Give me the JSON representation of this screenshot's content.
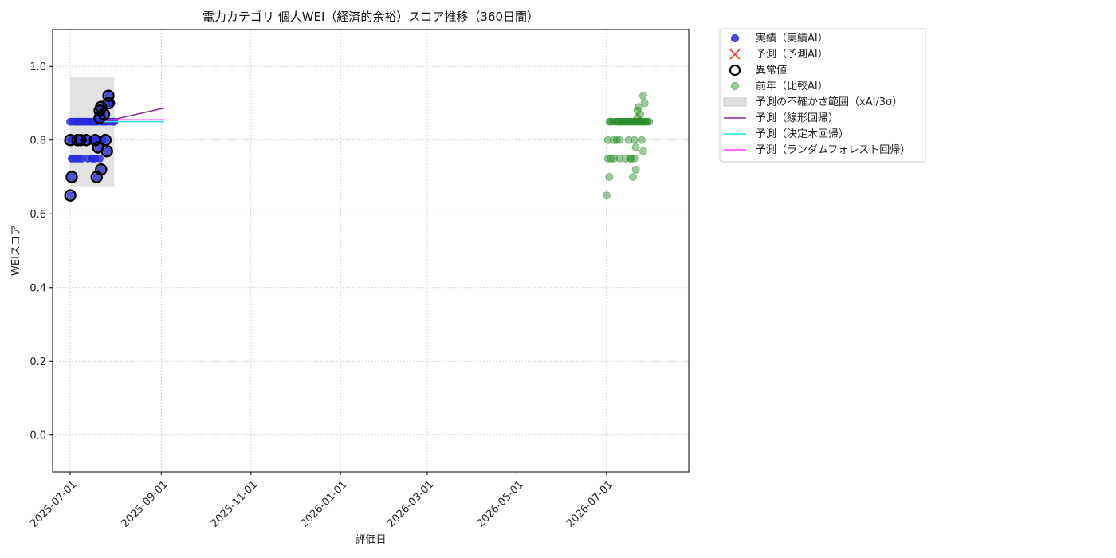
{
  "chart_data": {
    "type": "scatter",
    "title": "電力カテゴリ 個人WEI（経済的余裕）スコア推移（360日間）",
    "xlabel": "評価日",
    "ylabel": "WEIスコア",
    "xlim": [
      "2025-06-19",
      "2026-08-26"
    ],
    "ylim": [
      -0.1,
      1.1
    ],
    "x_ticks": [
      "2025-07-01",
      "2025-09-01",
      "2025-11-01",
      "2026-01-01",
      "2026-03-01",
      "2026-05-01",
      "2026-07-01"
    ],
    "y_ticks": [
      0.0,
      0.2,
      0.4,
      0.6,
      0.8,
      1.0
    ],
    "y_tick_labels": [
      "0.0",
      "0.2",
      "0.4",
      "0.6",
      "0.8",
      "1.0"
    ],
    "grid": true,
    "legend_placement": "outside-top-right",
    "colors": {
      "actual": "#2b2bdc",
      "predicted": "#ff3b3b",
      "anomaly": "#000000",
      "last_year": "#228b22",
      "uncertainty": "#d3d3d3",
      "linear": "#8e2c9a",
      "tree": "#22e0ee",
      "forest": "#ff33ff"
    },
    "series": [
      {
        "name": "実績（実績AI）",
        "kind": "scatter",
        "points": [
          [
            "2025-07-01",
            0.65
          ],
          [
            "2025-07-01",
            0.8
          ],
          [
            "2025-07-01",
            0.85
          ],
          [
            "2025-07-02",
            0.7
          ],
          [
            "2025-07-02",
            0.75
          ],
          [
            "2025-07-02",
            0.8
          ],
          [
            "2025-07-03",
            0.85
          ],
          [
            "2025-07-03",
            0.75
          ],
          [
            "2025-07-04",
            0.85
          ],
          [
            "2025-07-04",
            0.8
          ],
          [
            "2025-07-05",
            0.75
          ],
          [
            "2025-07-05",
            0.85
          ],
          [
            "2025-07-06",
            0.8
          ],
          [
            "2025-07-06",
            0.85
          ],
          [
            "2025-07-07",
            0.75
          ],
          [
            "2025-07-07",
            0.85
          ],
          [
            "2025-07-08",
            0.8
          ],
          [
            "2025-07-08",
            0.85
          ],
          [
            "2025-07-09",
            0.85
          ],
          [
            "2025-07-09",
            0.75
          ],
          [
            "2025-07-10",
            0.8
          ],
          [
            "2025-07-10",
            0.85
          ],
          [
            "2025-07-11",
            0.85
          ],
          [
            "2025-07-12",
            0.8
          ],
          [
            "2025-07-12",
            0.85
          ],
          [
            "2025-07-13",
            0.75
          ],
          [
            "2025-07-13",
            0.85
          ],
          [
            "2025-07-14",
            0.85
          ],
          [
            "2025-07-15",
            0.85
          ],
          [
            "2025-07-16",
            0.75
          ],
          [
            "2025-07-16",
            0.8
          ],
          [
            "2025-07-16",
            0.85
          ],
          [
            "2025-07-17",
            0.85
          ],
          [
            "2025-07-17",
            0.75
          ],
          [
            "2025-07-18",
            0.75
          ],
          [
            "2025-07-18",
            0.8
          ],
          [
            "2025-07-18",
            0.85
          ],
          [
            "2025-07-19",
            0.7
          ],
          [
            "2025-07-19",
            0.85
          ],
          [
            "2025-07-20",
            0.8
          ],
          [
            "2025-07-20",
            0.85
          ],
          [
            "2025-07-20",
            0.78
          ],
          [
            "2025-07-21",
            0.75
          ],
          [
            "2025-07-21",
            0.88
          ],
          [
            "2025-07-21",
            0.86
          ],
          [
            "2025-07-22",
            0.72
          ],
          [
            "2025-07-22",
            0.85
          ],
          [
            "2025-07-22",
            0.89
          ],
          [
            "2025-07-23",
            0.85
          ],
          [
            "2025-07-23",
            0.8
          ],
          [
            "2025-07-24",
            0.87
          ],
          [
            "2025-07-24",
            0.85
          ],
          [
            "2025-07-25",
            0.8
          ],
          [
            "2025-07-25",
            0.85
          ],
          [
            "2025-07-26",
            0.77
          ],
          [
            "2025-07-26",
            0.85
          ],
          [
            "2025-07-27",
            0.9
          ],
          [
            "2025-07-27",
            0.92
          ],
          [
            "2025-07-28",
            0.85
          ],
          [
            "2025-07-29",
            0.9
          ],
          [
            "2025-07-30",
            0.85
          ],
          [
            "2025-07-31",
            0.85
          ]
        ]
      },
      {
        "name": "予測（予測AI）",
        "kind": "scatter",
        "points": []
      },
      {
        "name": "異常値",
        "kind": "ring",
        "points": [
          [
            "2025-07-01",
            0.65
          ],
          [
            "2025-07-01",
            0.8
          ],
          [
            "2025-07-02",
            0.7
          ],
          [
            "2025-07-06",
            0.8
          ],
          [
            "2025-07-08",
            0.8
          ],
          [
            "2025-07-12",
            0.8
          ],
          [
            "2025-07-18",
            0.8
          ],
          [
            "2025-07-19",
            0.7
          ],
          [
            "2025-07-20",
            0.78
          ],
          [
            "2025-07-21",
            0.88
          ],
          [
            "2025-07-21",
            0.86
          ],
          [
            "2025-07-22",
            0.72
          ],
          [
            "2025-07-22",
            0.89
          ],
          [
            "2025-07-24",
            0.87
          ],
          [
            "2025-07-25",
            0.8
          ],
          [
            "2025-07-26",
            0.77
          ],
          [
            "2025-07-27",
            0.9
          ],
          [
            "2025-07-27",
            0.92
          ]
        ]
      },
      {
        "name": "前年（比較AI）",
        "kind": "scatter",
        "points": [
          [
            "2026-07-01",
            0.65
          ],
          [
            "2026-07-02",
            0.75
          ],
          [
            "2026-07-02",
            0.8
          ],
          [
            "2026-07-03",
            0.7
          ],
          [
            "2026-07-03",
            0.85
          ],
          [
            "2026-07-04",
            0.75
          ],
          [
            "2026-07-04",
            0.85
          ],
          [
            "2026-07-05",
            0.85
          ],
          [
            "2026-07-06",
            0.75
          ],
          [
            "2026-07-06",
            0.8
          ],
          [
            "2026-07-07",
            0.85
          ],
          [
            "2026-07-08",
            0.8
          ],
          [
            "2026-07-08",
            0.85
          ],
          [
            "2026-07-09",
            0.85
          ],
          [
            "2026-07-10",
            0.75
          ],
          [
            "2026-07-10",
            0.8
          ],
          [
            "2026-07-10",
            0.85
          ],
          [
            "2026-07-11",
            0.85
          ],
          [
            "2026-07-12",
            0.85
          ],
          [
            "2026-07-13",
            0.85
          ],
          [
            "2026-07-14",
            0.75
          ],
          [
            "2026-07-14",
            0.85
          ],
          [
            "2026-07-15",
            0.85
          ],
          [
            "2026-07-16",
            0.8
          ],
          [
            "2026-07-16",
            0.85
          ],
          [
            "2026-07-17",
            0.75
          ],
          [
            "2026-07-17",
            0.85
          ],
          [
            "2026-07-18",
            0.75
          ],
          [
            "2026-07-18",
            0.85
          ],
          [
            "2026-07-19",
            0.7
          ],
          [
            "2026-07-19",
            0.85
          ],
          [
            "2026-07-20",
            0.8
          ],
          [
            "2026-07-20",
            0.75
          ],
          [
            "2026-07-20",
            0.85
          ],
          [
            "2026-07-21",
            0.78
          ],
          [
            "2026-07-21",
            0.85
          ],
          [
            "2026-07-21",
            0.72
          ],
          [
            "2026-07-22",
            0.86
          ],
          [
            "2026-07-22",
            0.88
          ],
          [
            "2026-07-22",
            0.85
          ],
          [
            "2026-07-23",
            0.89
          ],
          [
            "2026-07-23",
            0.85
          ],
          [
            "2026-07-24",
            0.87
          ],
          [
            "2026-07-24",
            0.85
          ],
          [
            "2026-07-25",
            0.8
          ],
          [
            "2026-07-25",
            0.85
          ],
          [
            "2026-07-26",
            0.77
          ],
          [
            "2026-07-26",
            0.85
          ],
          [
            "2026-07-26",
            0.92
          ],
          [
            "2026-07-27",
            0.9
          ],
          [
            "2026-07-27",
            0.85
          ],
          [
            "2026-07-28",
            0.85
          ],
          [
            "2026-07-29",
            0.85
          ],
          [
            "2026-07-30",
            0.85
          ]
        ]
      },
      {
        "name": "予測の不確かさ範囲（xAI/3σ）",
        "kind": "band",
        "x_range": [
          "2025-07-01",
          "2025-07-31"
        ],
        "y_range": [
          0.675,
          0.97
        ]
      },
      {
        "name": "予測（線形回帰）",
        "kind": "line",
        "points": [
          [
            "2025-07-24",
            0.85
          ],
          [
            "2025-09-03",
            0.887
          ]
        ]
      },
      {
        "name": "予測（決定木回帰）",
        "kind": "line",
        "points": [
          [
            "2025-07-24",
            0.85
          ],
          [
            "2025-09-03",
            0.85
          ]
        ]
      },
      {
        "name": "予測（ランダムフォレスト回帰）",
        "kind": "line",
        "points": [
          [
            "2025-07-24",
            0.855
          ],
          [
            "2025-09-03",
            0.855
          ]
        ]
      }
    ]
  }
}
